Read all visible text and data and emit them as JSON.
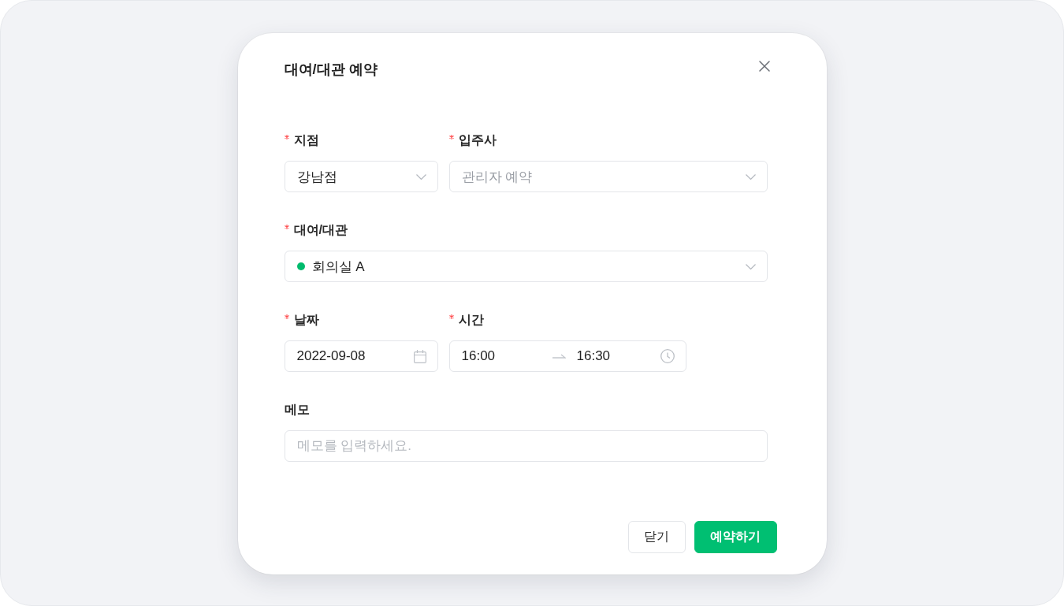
{
  "dialog": {
    "title": "대여/대관 예약"
  },
  "form": {
    "rows": [
      {
        "fields": [
          {
            "kind": "select",
            "label": "지점",
            "required": true,
            "value": "강남점"
          },
          {
            "kind": "select",
            "label": "입주사",
            "required": true,
            "placeholder": "관리자 예약"
          }
        ]
      },
      {
        "fields": [
          {
            "kind": "select",
            "label": "대여/대관",
            "required": true,
            "value": "회의실 A",
            "color": "#00bb6d"
          }
        ]
      },
      {
        "fields": [
          {
            "kind": "date",
            "label": "날짜",
            "required": true,
            "value": "2022-09-08"
          },
          {
            "kind": "time_range",
            "label": "시간",
            "required": true,
            "start": "16:00",
            "end": "16:30"
          }
        ]
      },
      {
        "fields": [
          {
            "kind": "text",
            "label": "메모",
            "required": false,
            "placeholder": "메모를 입력하세요."
          }
        ]
      }
    ]
  },
  "buttons": [
    {
      "kind": "secondary",
      "label": "닫기"
    },
    {
      "kind": "primary",
      "label": "예약하기"
    }
  ]
}
